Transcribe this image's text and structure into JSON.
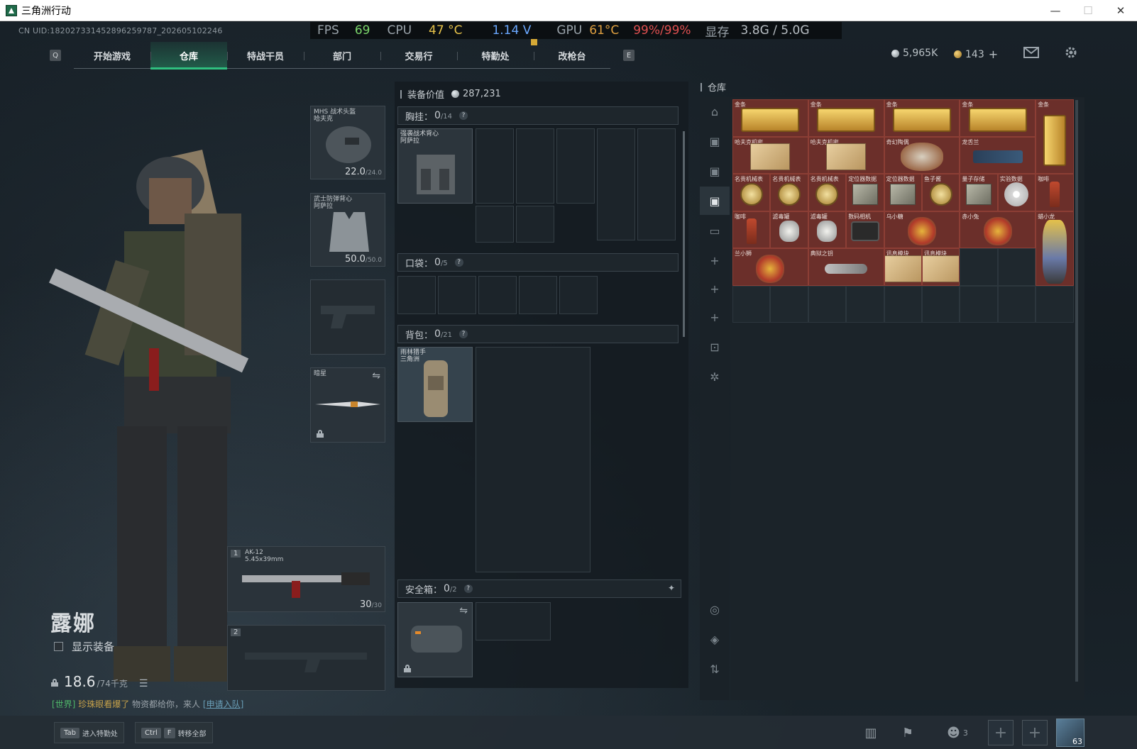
{
  "window": {
    "title": "三角洲行动",
    "icon": "delta-force-app-icon",
    "controls": {
      "minimize": "—",
      "maximize": "☐",
      "close": "✕"
    }
  },
  "uid": "CN UID:182027331452896259787_202605102246",
  "perf": {
    "fps_label": "FPS",
    "fps": "69",
    "cpu_label": "CPU",
    "cpu_temp": "47 °C",
    "cpu_volt": "1.14 V",
    "gpu_label": "GPU",
    "gpu_temp": "61°C",
    "gpu_usage": "99%/99%",
    "vram_label": "显存",
    "vram": "3.8G / 5.0G"
  },
  "nav": {
    "left_key": "Q",
    "right_key": "E",
    "tabs": [
      "开始游戏",
      "仓库",
      "特战干员",
      "部门",
      "交易行",
      "特勤处",
      "改枪台"
    ],
    "active_tab": "仓库"
  },
  "currency": {
    "silver": "5,965K",
    "gold": "143",
    "add": "+"
  },
  "top_icons": {
    "mail": "mail-icon",
    "settings": "gear-icon"
  },
  "operator": {
    "name": "露娜",
    "show_equipment": "显示装备",
    "weight": "18.6",
    "weight_max": "/74千克"
  },
  "chat": {
    "tag": "[世界]",
    "who": "珍珠眼看爆了",
    "msg": "物资都给你，来人",
    "link": "[申请入队]"
  },
  "equip": {
    "helmet": {
      "label": "MHS 战术头盔\n哈夫克",
      "dur": "22.0",
      "dur_max": "/24.0"
    },
    "armor": {
      "label": "武士防弹背心\n阿萨拉",
      "dur": "50.0",
      "dur_max": "/50.0"
    },
    "melee": {
      "label": "暗星"
    },
    "primary": {
      "index": "1",
      "name": "AK-12",
      "caliber": "5.45x39mm",
      "ammo": "30",
      "ammo_max": "/30"
    },
    "secondary": {
      "index": "2"
    }
  },
  "gear": {
    "value_label": "装备价值",
    "value": "287,231",
    "chest": {
      "label": "胸挂：",
      "cnt": "0",
      "max": "/14",
      "item": "强袭战术背心\n阿萨拉"
    },
    "pocket": {
      "label": "口袋：",
      "cnt": "0",
      "max": "/5"
    },
    "backpack": {
      "label": "背包：",
      "cnt": "0",
      "max": "/21",
      "item": "雨林猎手\n三角洲"
    },
    "safebox": {
      "label": "安全箱：",
      "cnt": "0",
      "max": "/2"
    },
    "help": "?"
  },
  "storage": {
    "title": "仓库",
    "items": [
      {
        "label": "金条",
        "pic": "gold-bar"
      },
      {
        "label": "金条",
        "pic": "gold-bar"
      },
      {
        "label": "金条",
        "pic": "gold-bar"
      },
      {
        "label": "金条",
        "pic": "gold-bar"
      },
      {
        "label": "金条",
        "pic": "gold-bar-v"
      },
      {
        "label": "哈夫克机密",
        "pic": "doc"
      },
      {
        "label": "哈夫克机密",
        "pic": "doc"
      },
      {
        "label": "奇幻陶偶",
        "pic": "statue"
      },
      {
        "label": "龙舌兰",
        "pic": "gun-img"
      },
      {
        "label": "名贵机械表",
        "pic": "watch"
      },
      {
        "label": "名贵机械表",
        "pic": "watch"
      },
      {
        "label": "名贵机械表",
        "pic": "watch"
      },
      {
        "label": "定位器数据",
        "pic": "device"
      },
      {
        "label": "定位器数据",
        "pic": "device"
      },
      {
        "label": "鱼子酱",
        "pic": "watch"
      },
      {
        "label": "量子存储",
        "pic": "device"
      },
      {
        "label": "实验数据",
        "pic": "disc"
      },
      {
        "label": "咖啡",
        "pic": "bottle"
      },
      {
        "label": "咖啡",
        "pic": "bottle"
      },
      {
        "label": "滤毒罐",
        "pic": "can"
      },
      {
        "label": "滤毒罐",
        "pic": "can"
      },
      {
        "label": "数码相机",
        "pic": "camera"
      },
      {
        "label": "乌小糖",
        "pic": "figure"
      },
      {
        "label": "赤小兔",
        "pic": "figure"
      },
      {
        "label": "蜡小龙",
        "pic": "figure-t"
      },
      {
        "label": "兰小狮",
        "pic": "figure"
      },
      {
        "label": "典狱之钥",
        "pic": "key"
      },
      {
        "label": "讯息模块",
        "pic": "doc"
      },
      {
        "label": "讯息模块",
        "pic": "doc"
      }
    ]
  },
  "bottom": {
    "hint1_key": "Tab",
    "hint1": "进入特勤处",
    "hint2_key1": "Ctrl",
    "hint2_key2": "F",
    "hint2": "转移全部",
    "players": "3",
    "avatar_level": "63"
  }
}
